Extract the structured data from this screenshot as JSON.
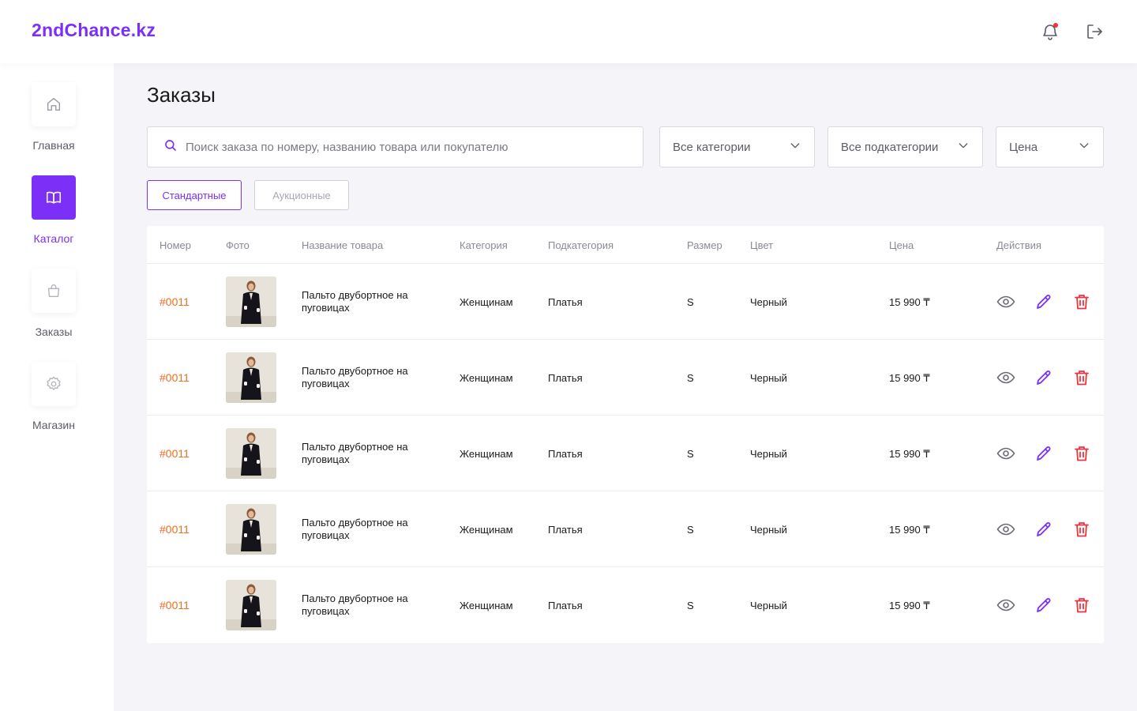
{
  "app": {
    "logo": "2ndChance.kz"
  },
  "header": {
    "notification_icon": "bell-icon",
    "logout_icon": "logout-icon",
    "has_unread": true
  },
  "sidebar": {
    "items": [
      {
        "label": "Главная",
        "icon": "home-icon",
        "active": false
      },
      {
        "label": "Каталог",
        "icon": "book-icon",
        "active": true
      },
      {
        "label": "Заказы",
        "icon": "bag-icon",
        "active": false
      },
      {
        "label": "Магазин",
        "icon": "gear-icon",
        "active": false
      }
    ]
  },
  "page": {
    "title": "Заказы"
  },
  "filters": {
    "search_placeholder": "Поиск заказа по номеру, названию товара или покупателю",
    "search_value": "",
    "category": "Все категории",
    "subcategory": "Все подкатегории",
    "price": "Цена"
  },
  "tabs": {
    "standard": "Стандартные",
    "auction": "Аукционные",
    "active": "standard"
  },
  "table": {
    "headers": {
      "number": "Номер",
      "photo": "Фото",
      "name": "Название товара",
      "category": "Категория",
      "subcategory": "Подкатегория",
      "size": "Размер",
      "color": "Цвет",
      "price": "Цена",
      "actions": "Действия"
    },
    "rows": [
      {
        "number": "#0011",
        "name_line1": "Пальто двубортное на",
        "name_line2": "пуговицах",
        "category": "Женщинам",
        "subcategory": "Платья",
        "size": "S",
        "color": "Черный",
        "price": "15 990 ₸"
      },
      {
        "number": "#0011",
        "name_line1": "Пальто двубортное на",
        "name_line2": "пуговицах",
        "category": "Женщинам",
        "subcategory": "Платья",
        "size": "S",
        "color": "Черный",
        "price": "15 990 ₸"
      },
      {
        "number": "#0011",
        "name_line1": "Пальто двубортное на",
        "name_line2": "пуговицах",
        "category": "Женщинам",
        "subcategory": "Платья",
        "size": "S",
        "color": "Черный",
        "price": "15 990 ₸"
      },
      {
        "number": "#0011",
        "name_line1": "Пальто двубортное на",
        "name_line2": "пуговицах",
        "category": "Женщинам",
        "subcategory": "Платья",
        "size": "S",
        "color": "Черный",
        "price": "15 990 ₸"
      },
      {
        "number": "#0011",
        "name_line1": "Пальто двубортное на",
        "name_line2": "пуговицах",
        "category": "Женщинам",
        "subcategory": "Платья",
        "size": "S",
        "color": "Черный",
        "price": "15 990 ₸"
      }
    ]
  },
  "colors": {
    "accent": "#7B2FF7",
    "order_number": "#F26B1D",
    "delete": "#F0323C",
    "view": "#6B6B75"
  }
}
